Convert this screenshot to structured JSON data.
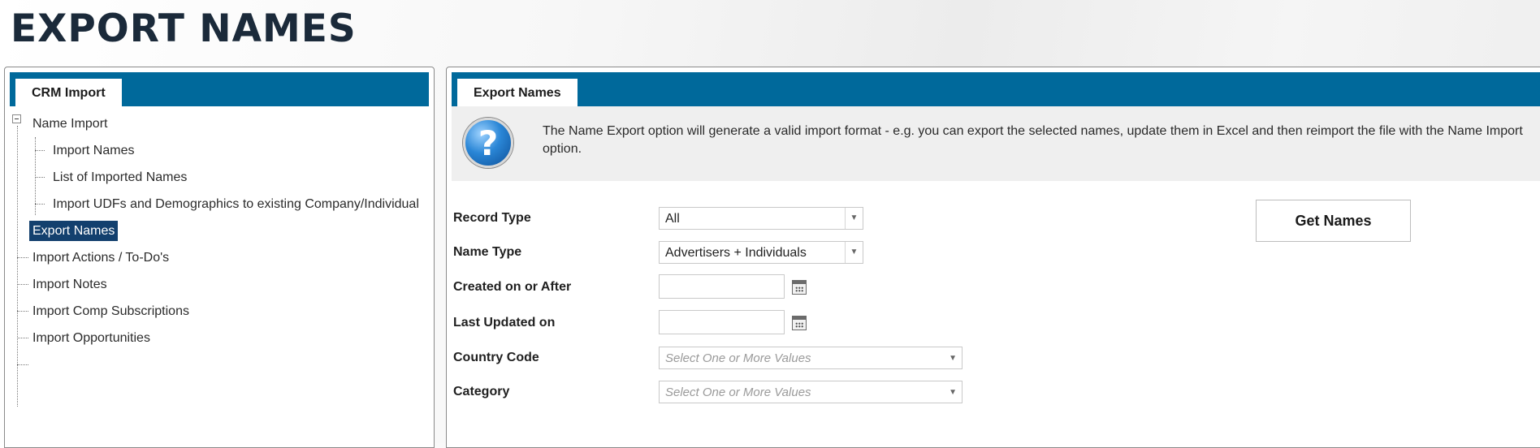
{
  "page": {
    "title": "EXPORT NAMES"
  },
  "left_panel": {
    "tab_label": "CRM Import",
    "tree": [
      {
        "label": "Name Import",
        "level": 0,
        "expanded": true
      },
      {
        "label": "Import Names",
        "level": 1
      },
      {
        "label": "List of Imported Names",
        "level": 1
      },
      {
        "label": "Import UDFs and Demographics to existing Company/Individual",
        "level": 1
      },
      {
        "label": "Export Names",
        "level": 0,
        "selected": true
      },
      {
        "label": "Import Actions / To-Do's",
        "level": 0
      },
      {
        "label": "Import Notes",
        "level": 0
      },
      {
        "label": "Import Comp Subscriptions",
        "level": 0
      },
      {
        "label": "Import Opportunities",
        "level": 0
      }
    ]
  },
  "right_panel": {
    "tab_label": "Export Names",
    "info_text": "The Name Export option will generate a valid import format - e.g. you can export the selected names, update them in Excel and then reimport the file with the Name Import option.",
    "help_icon_glyph": "?",
    "form": {
      "record_type": {
        "label": "Record Type",
        "value": "All"
      },
      "name_type": {
        "label": "Name Type",
        "value": "Advertisers + Individuals"
      },
      "created_after": {
        "label": "Created on or After",
        "value": ""
      },
      "last_updated": {
        "label": "Last Updated on",
        "value": ""
      },
      "country_code": {
        "label": "Country Code",
        "placeholder": "Select One or More Values"
      },
      "category": {
        "label": "Category",
        "placeholder": "Select One or More Values"
      }
    },
    "get_names_label": "Get Names"
  },
  "colors": {
    "tab_strip": "#00699b",
    "selected_item": "#13406e",
    "title": "#1b2a3a"
  }
}
